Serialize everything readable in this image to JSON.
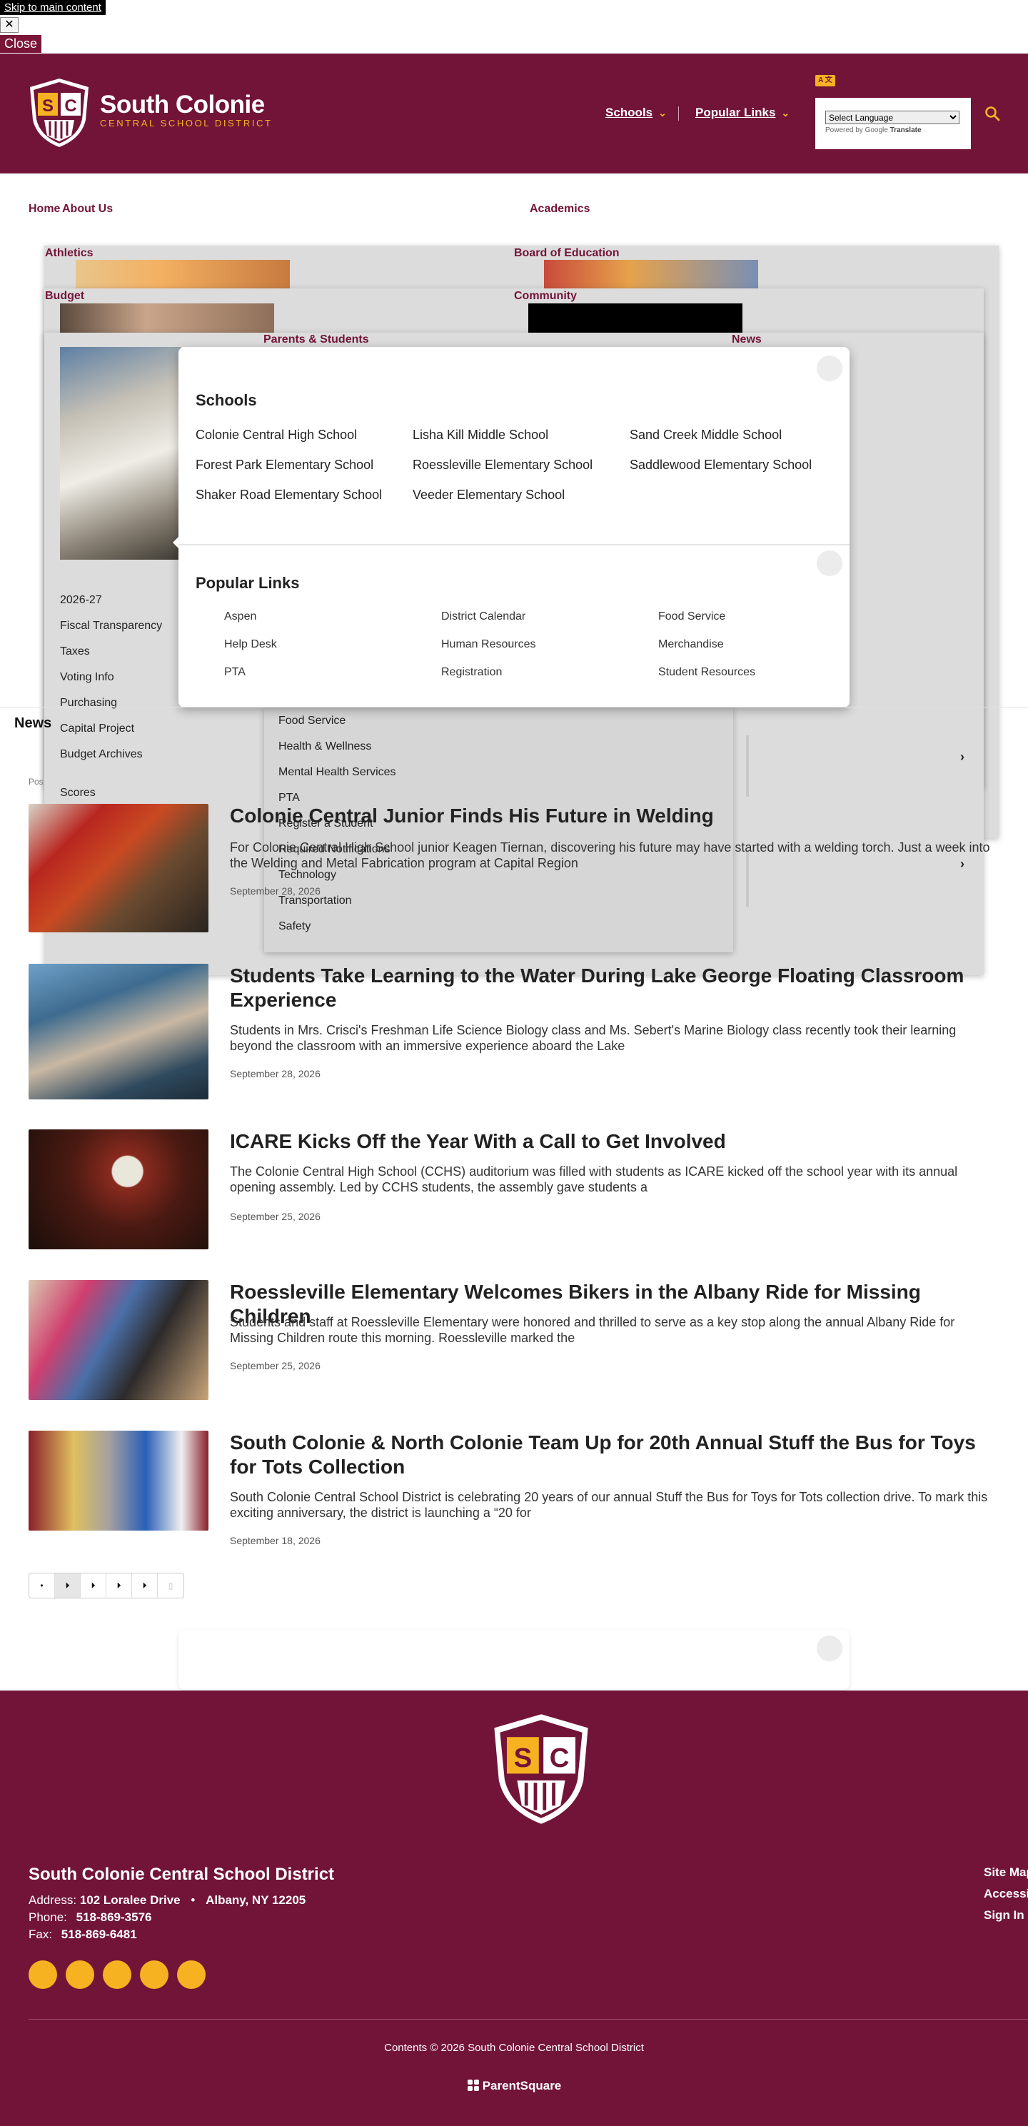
{
  "skip_link": "Skip to main content",
  "close_x": "✕",
  "close_label": "Close",
  "brand": {
    "name": "South Colonie",
    "sub": "CENTRAL SCHOOL DISTRICT",
    "shield_s": "S",
    "shield_c": "C"
  },
  "header_nav": {
    "schools": "Schools",
    "popular": "Popular Links"
  },
  "translate": {
    "icon_text": "A 文",
    "select_label": "Select Language",
    "powered": "Powered by",
    "google": "Google",
    "translate_word": "Translate"
  },
  "menu": {
    "home": "Home",
    "about": "About Us",
    "academics": "Academics",
    "athletics": "Athletics",
    "board": "Board of Education",
    "budget": "Budget",
    "community": "Community",
    "parents": "Parents & Students",
    "news": "News"
  },
  "budget_items": [
    "2026-27",
    "Fiscal Transparency",
    "Taxes",
    "Voting Info",
    "Purchasing",
    "Capital Project",
    "Budget Archives"
  ],
  "budget_scores": "Scores",
  "parents_items": [
    "Food Service",
    "Health & Wellness",
    "Mental Health Services",
    "PTA",
    "Register a Student",
    "Required Notifications",
    "Technology",
    "Transportation",
    "Safety"
  ],
  "schools_modal": {
    "title": "Schools",
    "items": [
      "Colonie Central High School",
      "Lisha Kill Middle School",
      "Sand Creek Middle School",
      "Forest Park Elementary School",
      "Roessleville Elementary School",
      "Saddlewood Elementary School",
      "Shaker Road Elementary School",
      "Veeder Elementary School"
    ]
  },
  "popular_modal": {
    "title": "Popular Links",
    "items": [
      "Aspen",
      "District Calendar",
      "Food Service",
      "Help Desk",
      "Human Resources",
      "Merchandise",
      "PTA",
      "Registration",
      "Student Resources"
    ]
  },
  "news_heading": "News",
  "posted_label": "Pos",
  "articles": [
    {
      "title": "Colonie Central Junior Finds His Future in Welding",
      "summary": "For Colonie Central High School junior Keagen Tiernan, discovering his future may have started with a welding torch. Just a week into the Welding and Metal Fabrication program at Capital Region",
      "date": "September 28, 2026"
    },
    {
      "title": "Students Take Learning to the Water During Lake George Floating Classroom Experience",
      "summary": "Students in Mrs. Crisci's Freshman Life Science Biology class and Ms. Sebert's Marine Biology class recently took their learning beyond the classroom with an immersive experience aboard the Lake",
      "date": "September 28, 2026"
    },
    {
      "title": "ICARE Kicks Off the Year With a Call to Get Involved",
      "summary": "The Colonie Central High School (CCHS) auditorium was filled with students as ICARE kicked off the school year with its annual opening assembly. Led by CCHS students, the assembly gave students a",
      "date": "September 25, 2026"
    },
    {
      "title": "Roessleville Elementary Welcomes Bikers in the Albany Ride for Missing Children",
      "summary": "Students and staff at Roessleville Elementary were honored and thrilled to serve as a key stop along the annual Albany Ride for Missing Children route this morning. Roessleville marked the",
      "date": "September 25, 2026"
    },
    {
      "title": "South Colonie & North Colonie Team Up for 20th Annual Stuff the Bus for Toys for Tots Collection",
      "summary": "South Colonie Central School District is celebrating 20 years of our annual Stuff the Bus for Toys for Tots collection drive. To mark this exciting anniversary, the district is launching a “20 for",
      "date": "September 18, 2026"
    }
  ],
  "pager": [
    "•",
    "⏵",
    "⏵",
    "⏵",
    "⏵",
    "▯"
  ],
  "footer": {
    "district": "South Colonie Central School District",
    "address_label": "Address:",
    "address_street": "102 Loralee Drive",
    "address_dot": "•",
    "address_city": "Albany, NY 12205",
    "phone_label": "Phone:",
    "phone": "518-869-3576",
    "fax_label": "Fax:",
    "fax": "518-869-6481",
    "links": [
      "Site Map",
      "Accessibility",
      "Sign In"
    ],
    "copyright": "Contents © 2026 South Colonie Central School District",
    "parentsquare": "ParentSquare"
  },
  "colors": {
    "maroon": "#721438",
    "gold": "#f6b221"
  }
}
